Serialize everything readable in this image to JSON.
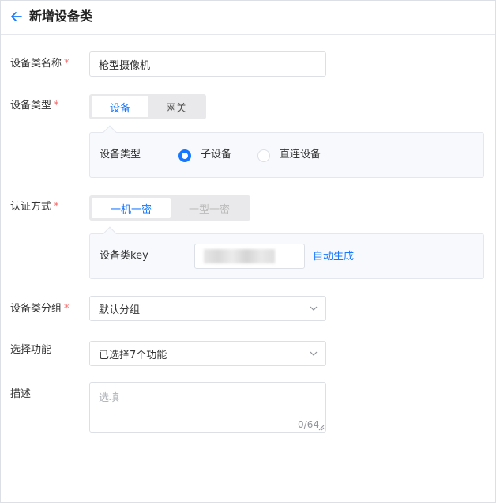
{
  "header": {
    "title": "新增设备类",
    "back_icon": "arrow-left-icon"
  },
  "colors": {
    "accent": "#1677ff",
    "required": "#f56c6c",
    "panel_bg": "#f7f9fc"
  },
  "form": {
    "name": {
      "label": "设备类名称",
      "required_mark": "*",
      "value": "枪型摄像机"
    },
    "device_type": {
      "label": "设备类型",
      "required_mark": "*",
      "options": [
        "设备",
        "网关"
      ],
      "selected": "设备",
      "sub": {
        "label": "设备类型",
        "radios": [
          {
            "label": "子设备",
            "checked": true
          },
          {
            "label": "直连设备",
            "checked": false
          }
        ]
      }
    },
    "auth": {
      "label": "认证方式",
      "required_mark": "*",
      "options": [
        "一机一密",
        "一型一密"
      ],
      "selected": "一机一密",
      "key": {
        "label": "设备类key",
        "action": "自动生成"
      }
    },
    "group": {
      "label": "设备类分组",
      "required_mark": "*",
      "value": "默认分组"
    },
    "functions": {
      "label": "选择功能",
      "value": "已选择7个功能"
    },
    "description": {
      "label": "描述",
      "placeholder": "选填",
      "counter": "0/64"
    }
  }
}
